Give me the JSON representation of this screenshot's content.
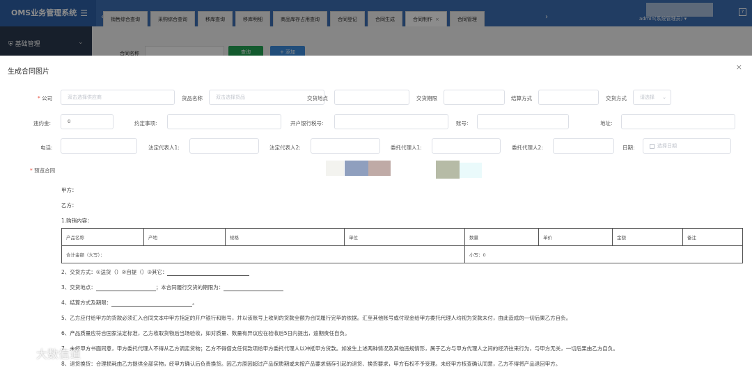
{
  "app": {
    "title": "OMS业务管理系统"
  },
  "tabs": [
    {
      "label": "销售综合查询"
    },
    {
      "label": "采购综合查询"
    },
    {
      "label": "移库查询"
    },
    {
      "label": "移库明细"
    },
    {
      "label": "商品库存占用查询"
    },
    {
      "label": "合同登记"
    },
    {
      "label": "合同生成"
    },
    {
      "label": "合同制作",
      "closable": "×"
    },
    {
      "label": "合同管理"
    }
  ],
  "user": {
    "name": "admin(系统管理员)"
  },
  "sidebar": {
    "group": "基础管理"
  },
  "filter": {
    "label": "合同名称",
    "query": "查询",
    "add": "+ 添加"
  },
  "modal": {
    "title": "生成合同图片",
    "close": "×",
    "fields": {
      "company": {
        "label": "公司",
        "placeholder": "双击选择供应商"
      },
      "goods": {
        "label": "货品名称",
        "placeholder": "双击选择货品"
      },
      "place": {
        "label": "交货地点"
      },
      "period": {
        "label": "交货期限"
      },
      "settle": {
        "label": "结算方式"
      },
      "delivery": {
        "label": "交货方式",
        "placeholder": "请选择"
      },
      "penalty": {
        "label": "违约金:",
        "value": "0"
      },
      "terms": {
        "label": "约定事项:"
      },
      "bank": {
        "label": "开户银行税号:"
      },
      "account": {
        "label": "账号:"
      },
      "address": {
        "label": "地址:"
      },
      "phone": {
        "label": "电话:"
      },
      "rep1": {
        "label": "法定代表人1:"
      },
      "rep2": {
        "label": "法定代表人2:"
      },
      "agent1": {
        "label": "委托代理人1:"
      },
      "agent2": {
        "label": "委托代理人2:"
      },
      "date": {
        "label": "日期:",
        "placeholder": "选择日期"
      }
    },
    "preview_label": "预览合同",
    "doc": {
      "party_a": "甲方：",
      "party_b": "乙方：",
      "section1": "1.购销内容：",
      "table_headers": [
        "产品名称",
        "产地",
        "规格",
        "单位",
        "数量",
        "单价",
        "金额",
        "备注"
      ],
      "total_label": "合计金额（大写）：",
      "subtotal_label": "小写：0",
      "l2": "2、交货方式：①送货（）②自提（）③其它：",
      "l3a": "3、交货地点：",
      "l3b": "；本合同履行交货的期限为：",
      "l4": "4、结算方式及期限：",
      "l5": "5、乙方应付给甲方的货款必须汇入合同文本中甲方指定的开户银行和账号，并以该账号上收到的货款全额为合同履行完毕的依据。汇至其他账号或付现金给甲方委托代理人均视为货款未付，由此造成的一切后果乙方自负。",
      "l6": "6、产品质量应符合国家法定标准，乙方收取货物后当场验收，如对质量、数量有异议应在验收后5日内提出，逾期责任自负。",
      "l7": "7、未经甲方书面同意，甲方委托代理人不得从乙方调走货物；乙方不得借支任何款项给甲方委托代理人以冲抵甲方货款。如发生上述两种情况及其他违规情形，属于乙方与甲方代理人之间的经济往来行为，与甲方无关，一切后果由乙方自负。",
      "l8": "8、退货换货：合理损耗由乙方提供全部实物，经甲方确认后负责换货。因乙方原因超过产品保质期或未按产品要求储存引起的退货、换货要求，甲方有权不予受理。未经甲方核查确认同意，乙方不得将产品退回甲方。"
    }
  },
  "watermark": "大数信道"
}
